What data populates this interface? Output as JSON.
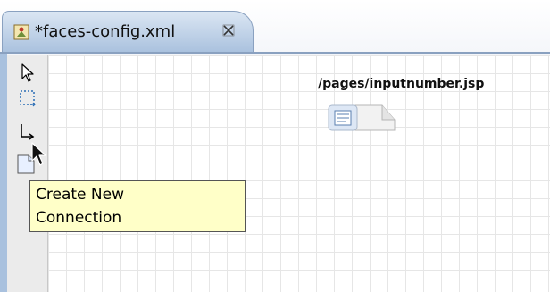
{
  "editor_tab": {
    "title": "*faces-config.xml",
    "file_icon": "faces-config-file-icon",
    "close_icon": "close-icon"
  },
  "palette": {
    "tools": [
      {
        "name": "select-tool",
        "icon": "arrow-pointer-icon"
      },
      {
        "name": "marquee-tool",
        "icon": "dashed-rectangle-icon"
      },
      {
        "name": "create-connection-tool",
        "icon": "connection-icon"
      },
      {
        "name": "page-tool",
        "icon": "page-icon"
      }
    ]
  },
  "canvas": {
    "page_node": {
      "label": "/pages/inputnumber.jsp",
      "icon": "jsp-page-icon"
    }
  },
  "tooltip": {
    "line1": "Create New",
    "line2": "Connection"
  },
  "colors": {
    "tab_active": "#a9c1de",
    "tooltip_bg": "#ffffc8",
    "palette_bg": "#ebebeb",
    "grid_line": "#e6e6e6"
  }
}
